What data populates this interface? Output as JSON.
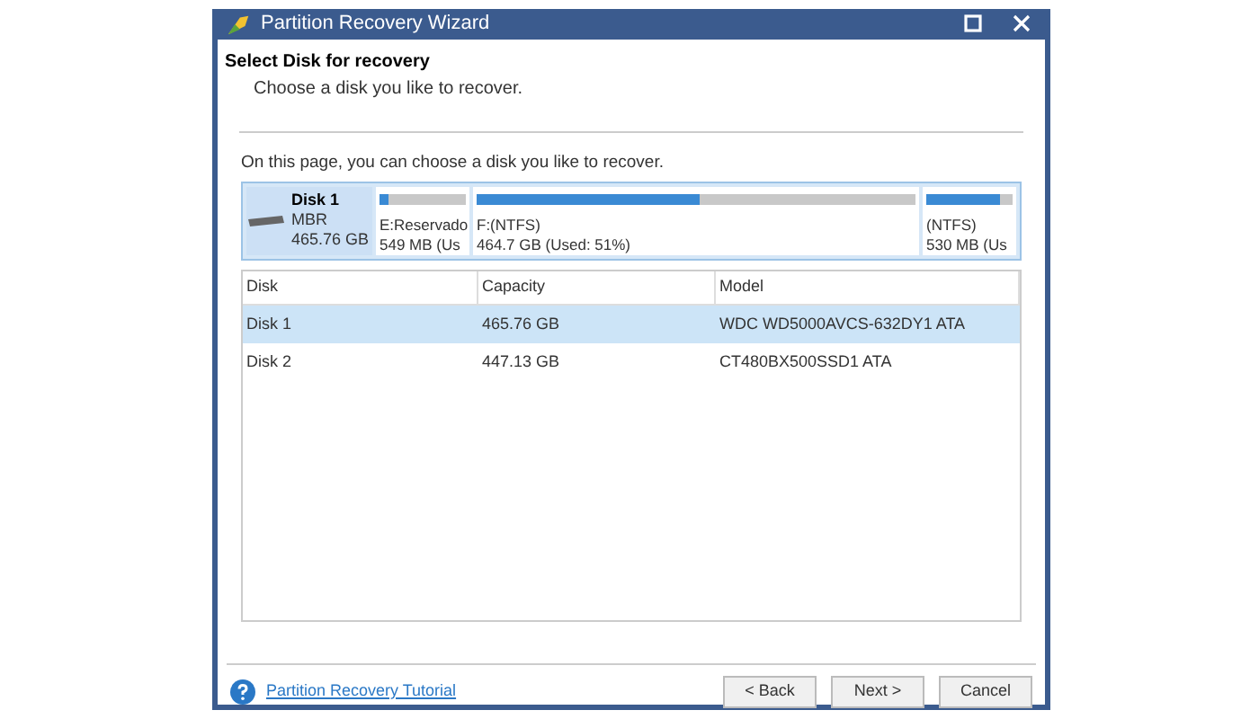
{
  "window": {
    "title": "Partition Recovery Wizard"
  },
  "header": {
    "title": "Select Disk for recovery",
    "subtitle": "Choose a disk you like to recover."
  },
  "intro": "On this page, you can choose a disk you like to recover.",
  "disk_map": {
    "disk": {
      "name": "Disk 1",
      "scheme": "MBR",
      "size": "465.76 GB",
      "selected": true
    },
    "partitions": [
      {
        "label": "E:Reservado",
        "size": "549 MB (Us",
        "level": 0.1
      },
      {
        "label": "F:(NTFS)",
        "size": "464.7 GB (Used: 51%)",
        "level": 0.51
      },
      {
        "label": "(NTFS)",
        "size": "530 MB (Us",
        "level": 0.85
      }
    ]
  },
  "table": {
    "columns": [
      "Disk",
      "Capacity",
      "Model"
    ],
    "rows": [
      {
        "cells": [
          "Disk 1",
          "465.76 GB",
          "WDC WD5000AVCS-632DY1 ATA"
        ],
        "selected": true
      },
      {
        "cells": [
          "Disk 2",
          "447.13 GB",
          "CT480BX500SSD1 ATA"
        ],
        "selected": false
      }
    ]
  },
  "footer": {
    "link": "Partition Recovery Tutorial",
    "buttons": [
      "< Back",
      "Next >",
      "Cancel"
    ]
  }
}
